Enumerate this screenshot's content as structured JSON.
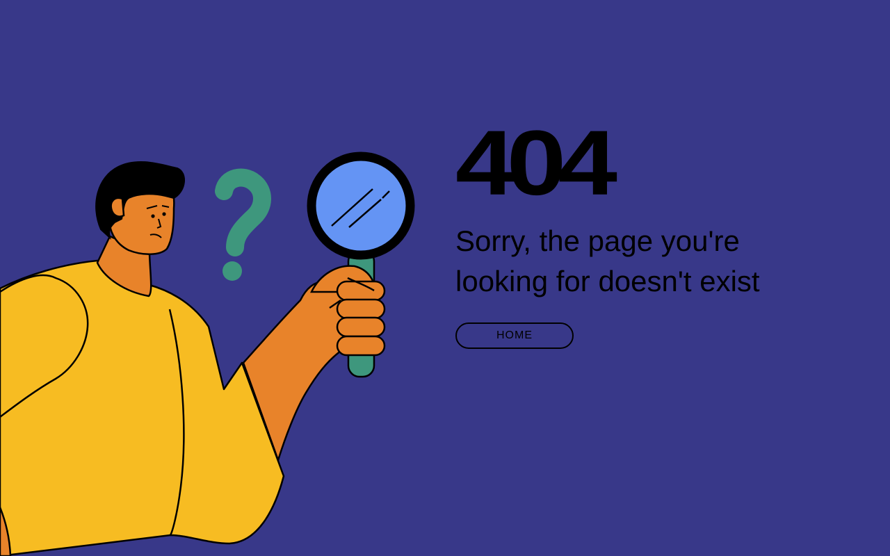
{
  "error": {
    "code": "404",
    "message": "Sorry, the page you're looking for doesn't exist"
  },
  "actions": {
    "home_label": "HOME"
  },
  "colors": {
    "background": "#383889",
    "text": "#000000",
    "shirt": "#F7BC22",
    "skin": "#E8832A",
    "lens": "#6494F4",
    "handle": "#3E977D",
    "question_mark": "#3E977D"
  },
  "icons": {
    "illustration": "confused-man-with-magnifying-glass",
    "question_mark": "question-mark-icon",
    "magnifier": "magnifying-glass-icon"
  }
}
